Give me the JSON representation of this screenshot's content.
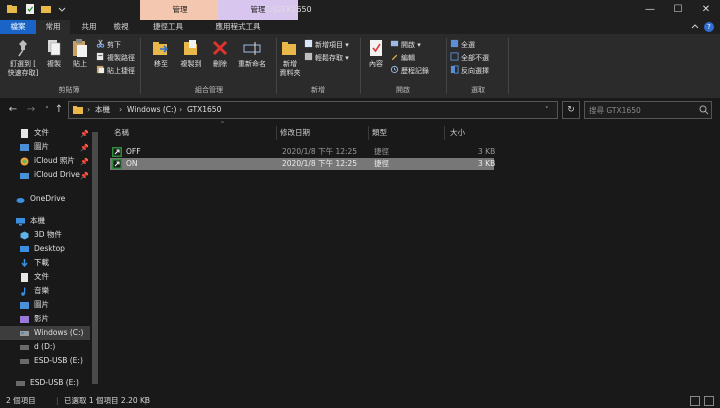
{
  "window": {
    "context_tab_1": "管理",
    "context_tab_2": "管理",
    "title": "C:\\GTX1650",
    "minimize": "—",
    "maximize": "☐",
    "close": "✕"
  },
  "tabs": {
    "file": "檔案",
    "home": "常用",
    "share": "共用",
    "view": "檢視",
    "shortcut_tools": "捷徑工具",
    "app_tools": "應用程式工具"
  },
  "ribbon": {
    "clipboard": {
      "label": "剪貼簿",
      "pin_quick_access": "釘選到 [",
      "pin_quick_access_2": "快速存取]",
      "copy": "複製",
      "paste": "貼上",
      "cut": "剪下",
      "copy_path": "複製路徑",
      "paste_shortcut": "貼上捷徑"
    },
    "organize": {
      "label": "組合管理",
      "move_to": "移至",
      "copy_to": "複製到",
      "delete": "刪除",
      "rename": "重新命名"
    },
    "new": {
      "label": "新增",
      "new_folder": "新增",
      "new_folder_2": "資料夾",
      "new_item": "新增項目",
      "easy_access": "輕鬆存取"
    },
    "open": {
      "label": "開啟",
      "properties": "內容",
      "open": "開啟",
      "edit": "編輯",
      "history": "歷程記錄"
    },
    "select": {
      "label": "選取",
      "select_all": "全選",
      "select_none": "全部不選",
      "invert": "反向選擇"
    }
  },
  "address": {
    "crumbs": [
      "本機",
      "Windows (C:)",
      "GTX1650"
    ],
    "search_placeholder": "搜尋 GTX1650"
  },
  "sidebar": {
    "items": [
      {
        "label": "文件",
        "pinned": true
      },
      {
        "label": "圖片",
        "pinned": true
      },
      {
        "label": "iCloud 照片",
        "pinned": true
      },
      {
        "label": "iCloud Drive",
        "pinned": true
      },
      {
        "label": "OneDrive"
      },
      {
        "label": "本機"
      },
      {
        "label": "3D 物件"
      },
      {
        "label": "Desktop"
      },
      {
        "label": "下載"
      },
      {
        "label": "文件"
      },
      {
        "label": "音樂"
      },
      {
        "label": "圖片"
      },
      {
        "label": "影片"
      },
      {
        "label": "Windows (C:)"
      },
      {
        "label": "d (D:)"
      },
      {
        "label": "ESD-USB (E:)"
      },
      {
        "label": "ESD-USB (E:)"
      }
    ],
    "pin_glyph": "📌"
  },
  "files": {
    "columns": [
      "名稱",
      "修改日期",
      "類型",
      "大小"
    ],
    "sort_glyph": "^",
    "rows": [
      {
        "name": "OFF",
        "modified": "2020/1/8 下午 12:25",
        "type": "捷徑",
        "size": "3 KB"
      },
      {
        "name": "ON",
        "modified": "2020/1/8 下午 12:25",
        "type": "捷徑",
        "size": "3 KB"
      }
    ]
  },
  "status": {
    "items": "2 個項目",
    "selected": "已選取 1 個項目  2.20 KB"
  },
  "colors": {
    "file_tab": "#1a64c8",
    "context_tab_1": "#f4c8b0",
    "context_tab_2": "#d9c6ef",
    "folder": "#e8b84a",
    "delete": "#e0332e"
  }
}
